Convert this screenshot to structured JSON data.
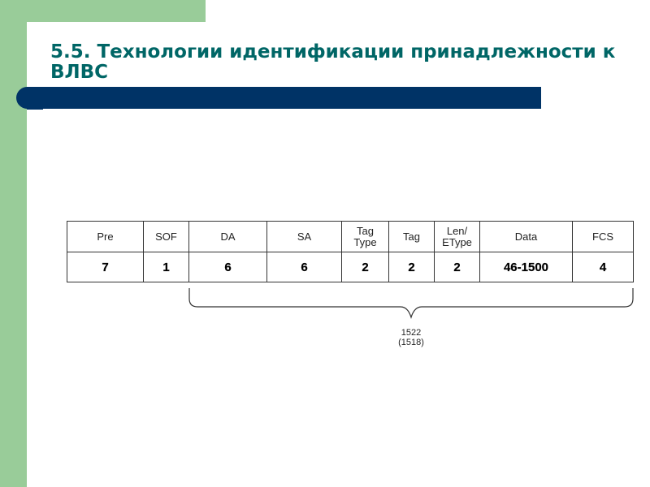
{
  "slide": {
    "title_line1": "5.5. Технологии идентификации принадлежности к",
    "title_line2": "ВЛВС",
    "colors": {
      "accent_green": "#99cc99",
      "title_teal": "#006666",
      "bar_navy": "#003366"
    }
  },
  "frame": {
    "headers": [
      "Pre",
      "SOF",
      "DA",
      "SA",
      "Tag\nType",
      "Tag",
      "Len/\nEType",
      "Data",
      "FCS"
    ],
    "header_lines": [
      [
        "Pre"
      ],
      [
        "SOF"
      ],
      [
        "DA"
      ],
      [
        "SA"
      ],
      [
        "Tag",
        "Type"
      ],
      [
        "Tag"
      ],
      [
        "Len/",
        "EType"
      ],
      [
        "Data"
      ],
      [
        "FCS"
      ]
    ],
    "sizes": [
      "7",
      "1",
      "6",
      "6",
      "2",
      "2",
      "2",
      "46-1500",
      "4"
    ],
    "brace_total": "1522",
    "brace_total_alt": "(1518)"
  }
}
